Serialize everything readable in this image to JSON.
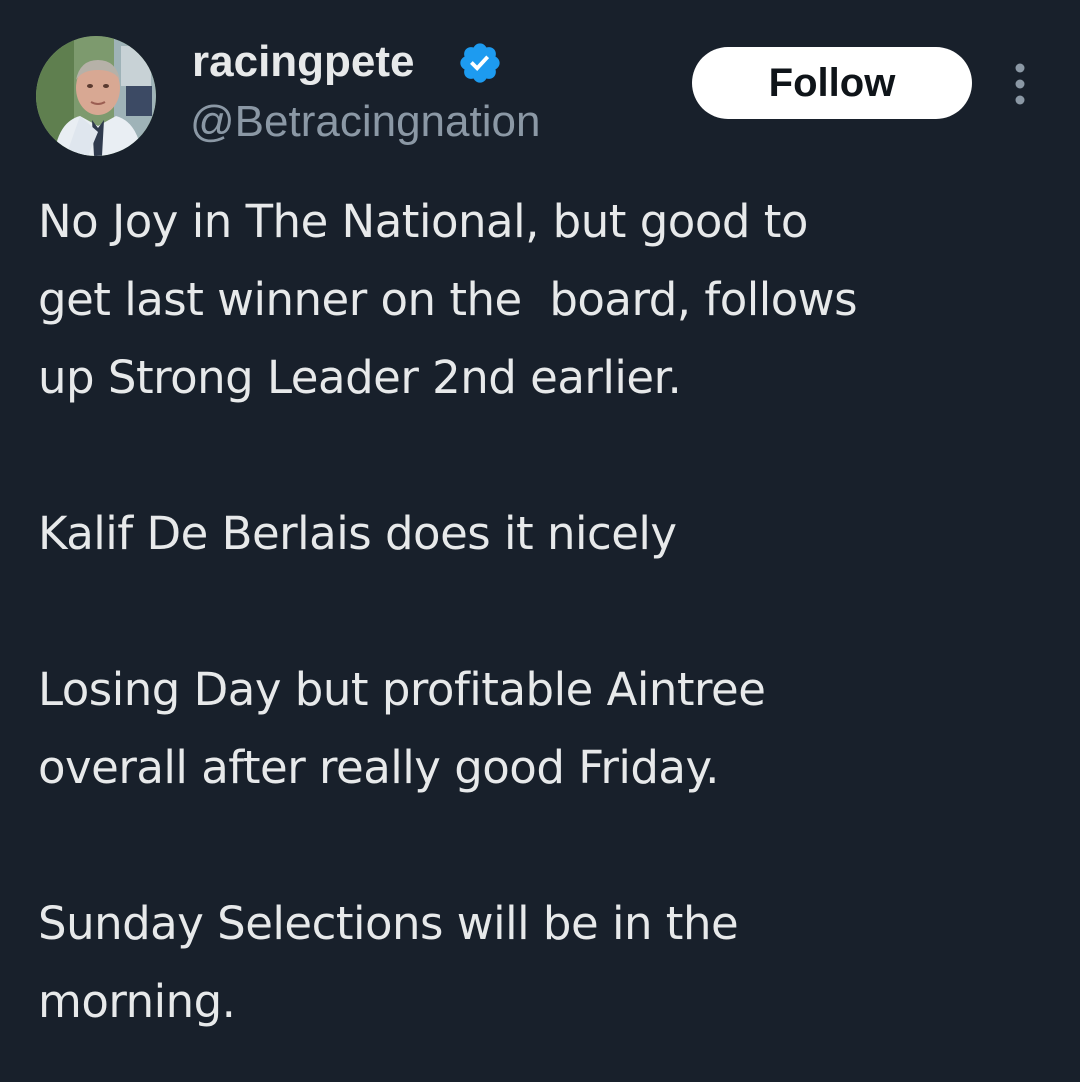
{
  "tweet": {
    "author": {
      "display_name": "racingpete",
      "handle": "@Betracingnation",
      "verified": true,
      "avatar_icon": "profile-photo",
      "verified_icon": "verified-badge-icon",
      "verified_color": "#1d9bf0"
    },
    "follow_label": "Follow",
    "more_icon": "more-options-icon",
    "paragraphs": [
      "No Joy in The National, but good to\nget last winner on the  board, follows\nup Strong Leader 2nd earlier.",
      "Kalif De Berlais does it nicely",
      "Losing Day but profitable Aintree\noverall after really good Friday.",
      "Sunday Selections will be in the\nmorning."
    ]
  },
  "colors": {
    "background": "#18202b",
    "text_primary": "#e7e9ea",
    "text_secondary": "#8b98a5",
    "button_bg": "#ffffff",
    "button_text": "#0f1419"
  }
}
